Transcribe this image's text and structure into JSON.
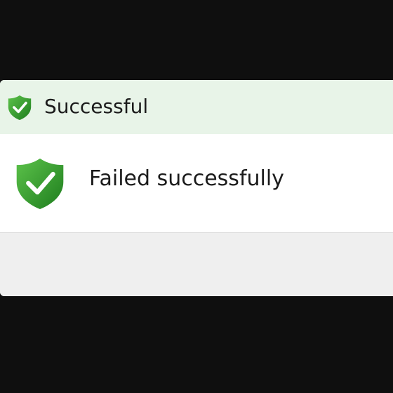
{
  "dialog": {
    "title": "Successful",
    "title_icon": "shield-check-icon",
    "message": "Failed successfully",
    "message_icon": "shield-check-icon"
  },
  "colors": {
    "shield_green_light": "#4caf3f",
    "shield_green_dark": "#1f7a1f",
    "title_bar_bg": "#e8f4e8",
    "content_bg": "#ffffff",
    "footer_bg": "#efefef",
    "backdrop": "#0f0f0f"
  }
}
